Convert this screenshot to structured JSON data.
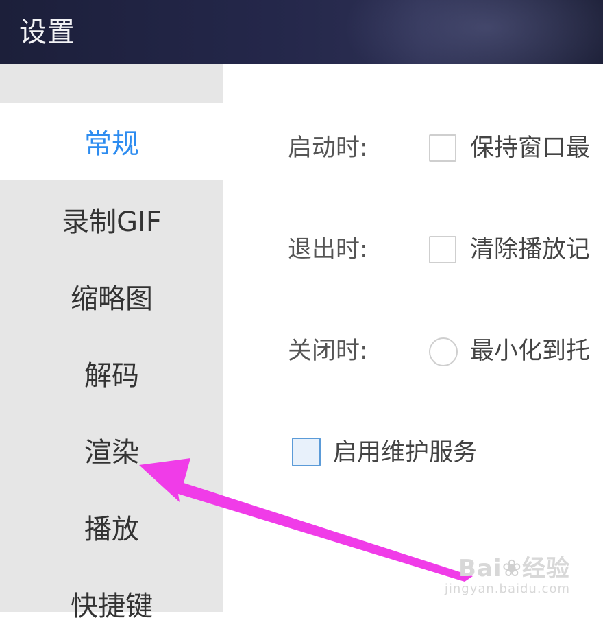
{
  "window": {
    "title": "设置"
  },
  "sidebar": {
    "items": [
      {
        "label": "常规",
        "active": true
      },
      {
        "label": "录制GIF",
        "active": false
      },
      {
        "label": "缩略图",
        "active": false
      },
      {
        "label": "解码",
        "active": false
      },
      {
        "label": "渲染",
        "active": false
      },
      {
        "label": "播放",
        "active": false
      },
      {
        "label": "快捷键",
        "active": false
      }
    ]
  },
  "general": {
    "startup": {
      "label": "启动时:",
      "option": "保持窗口最"
    },
    "exit": {
      "label": "退出时:",
      "option": "清除播放记"
    },
    "close": {
      "label": "关闭时:",
      "option": "最小化到托"
    },
    "maintenance": {
      "option": "启用维护服务"
    }
  },
  "watermark": {
    "logo_left": "Bai",
    "logo_right": "经验",
    "url": "jingyan.baidu.com"
  },
  "colors": {
    "accent": "#2d8cf0",
    "annotation_arrow": "#f03ce8",
    "sidebar_bg": "#e6e6e6",
    "titlebar_bg": "#24274a"
  },
  "icons": {
    "annotation": "arrow-pointer-icon",
    "watermark": "baidu-paw-icon"
  }
}
